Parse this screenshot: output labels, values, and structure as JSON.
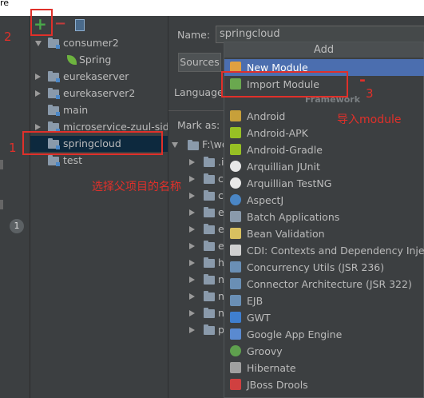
{
  "top_label": "re",
  "toolbar": {
    "add_icon": "+",
    "remove_icon": "−"
  },
  "leftstrip": {
    "badge": "1"
  },
  "tree": [
    {
      "label": "consumer2",
      "expand": "down",
      "indent": 0
    },
    {
      "label": "Spring",
      "expand": "none",
      "indent": 1,
      "icon": "spring"
    },
    {
      "label": "eurekaserver",
      "expand": "right",
      "indent": 0
    },
    {
      "label": "eurekaserver2",
      "expand": "right",
      "indent": 0
    },
    {
      "label": "main",
      "expand": "none",
      "indent": 0
    },
    {
      "label": "microservice-zuul-sidec",
      "expand": "right",
      "indent": 0
    },
    {
      "label": "springcloud",
      "expand": "none",
      "indent": 0,
      "selected": true
    },
    {
      "label": "test",
      "expand": "none",
      "indent": 0
    }
  ],
  "form": {
    "name_label": "Name:",
    "name_value": "springcloud",
    "tab_sources": "Sources",
    "language_label": "Language",
    "markas_label": "Mark as:",
    "path_root": "F:\\wo",
    "path_children": [
      ".i",
      "c",
      "c",
      "e",
      "e",
      "e",
      "h",
      "n",
      "n",
      "n",
      "p"
    ]
  },
  "popup": {
    "title": "Add",
    "section_label": "Framework",
    "items": [
      {
        "label": "New Module",
        "icon": "module",
        "color": "#e0a040"
      },
      {
        "label": "Import Module",
        "icon": "import",
        "color": "#6aa84f"
      },
      {
        "label": "Android",
        "icon": "android-folder",
        "color": "#c7a03a"
      },
      {
        "label": "Android-APK",
        "icon": "android",
        "color": "#97c024"
      },
      {
        "label": "Android-Gradle",
        "icon": "android",
        "color": "#97c024"
      },
      {
        "label": "Arquillian JUnit",
        "icon": "arquillian",
        "color": "#e8e8e8"
      },
      {
        "label": "Arquillian TestNG",
        "icon": "arquillian",
        "color": "#e8e8e8"
      },
      {
        "label": "AspectJ",
        "icon": "aspectj",
        "color": "#4a86c5"
      },
      {
        "label": "Batch Applications",
        "icon": "batch",
        "color": "#8a9aab"
      },
      {
        "label": "Bean Validation",
        "icon": "bean",
        "color": "#d8c060"
      },
      {
        "label": "CDI: Contexts and Dependency Injectio",
        "icon": "cdi",
        "color": "#d0d0d0"
      },
      {
        "label": "Concurrency Utils (JSR 236)",
        "icon": "jsr",
        "color": "#6a8fb5"
      },
      {
        "label": "Connector Architecture (JSR 322)",
        "icon": "jsr",
        "color": "#6a8fb5"
      },
      {
        "label": "EJB",
        "icon": "ejb",
        "color": "#6a8fb5"
      },
      {
        "label": "GWT",
        "icon": "gwt",
        "color": "#3f7fd0"
      },
      {
        "label": "Google App Engine",
        "icon": "gae",
        "color": "#5a8ad0"
      },
      {
        "label": "Groovy",
        "icon": "groovy",
        "color": "#5fa04e"
      },
      {
        "label": "Hibernate",
        "icon": "hibernate",
        "color": "#a0a0a0"
      },
      {
        "label": "JBoss Drools",
        "icon": "drools",
        "color": "#d04040"
      }
    ]
  },
  "annotations": {
    "n1": "1",
    "n2": "2",
    "n3": "3",
    "dash": "-",
    "choose_parent": "选择父项目的名称",
    "import_module": "导入module"
  }
}
